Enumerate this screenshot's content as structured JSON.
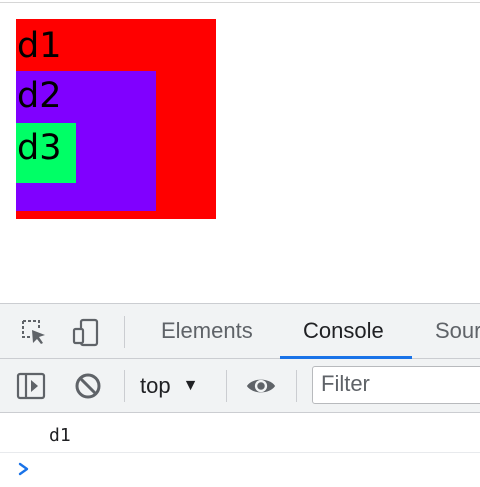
{
  "boxes": {
    "d1": {
      "label": "d1",
      "color": "#ff0000"
    },
    "d2": {
      "label": "d2",
      "color": "#8000ff"
    },
    "d3": {
      "label": "d3",
      "color": "#00ff66"
    }
  },
  "devtools": {
    "tabs": [
      {
        "label": "Elements",
        "active": false
      },
      {
        "label": "Console",
        "active": true
      },
      {
        "label": "Sour",
        "active": false
      }
    ],
    "toolbar": {
      "context": "top",
      "filter_placeholder": "Filter",
      "filter_value": ""
    },
    "console": {
      "lines": [
        {
          "text": "d1"
        }
      ],
      "prompt_icon": "chevron-right-icon"
    },
    "icons": {
      "inspect": "inspect-element-icon",
      "device": "device-toolbar-icon",
      "sidebar": "show-sidebar-icon",
      "clear": "clear-console-icon",
      "eye": "live-expression-icon"
    },
    "colors": {
      "accent": "#1a73e8",
      "toolbar_bg": "#f1f3f4",
      "icon": "#5f6368"
    }
  }
}
